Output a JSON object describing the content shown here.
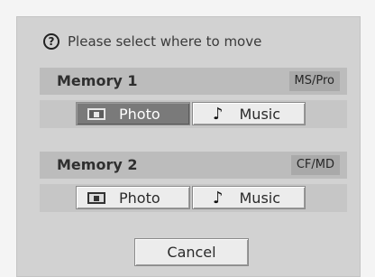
{
  "prompt": {
    "text": "Please select where to move",
    "icon": "question-icon"
  },
  "sections": [
    {
      "title": "Memory 1",
      "badge": "MS/Pro",
      "buttons": [
        {
          "label": "Photo",
          "icon": "photo-icon",
          "selected": true
        },
        {
          "label": "Music",
          "icon": "music-note-icon",
          "selected": false
        }
      ]
    },
    {
      "title": "Memory 2",
      "badge": "CF/MD",
      "buttons": [
        {
          "label": "Photo",
          "icon": "photo-icon",
          "selected": false
        },
        {
          "label": "Music",
          "icon": "music-note-icon",
          "selected": false
        }
      ]
    }
  ],
  "cancel_label": "Cancel",
  "colors": {
    "dialog_bg": "#d2d2d2",
    "selected_button": "#7a7a7a",
    "button_bg": "#ececec"
  }
}
